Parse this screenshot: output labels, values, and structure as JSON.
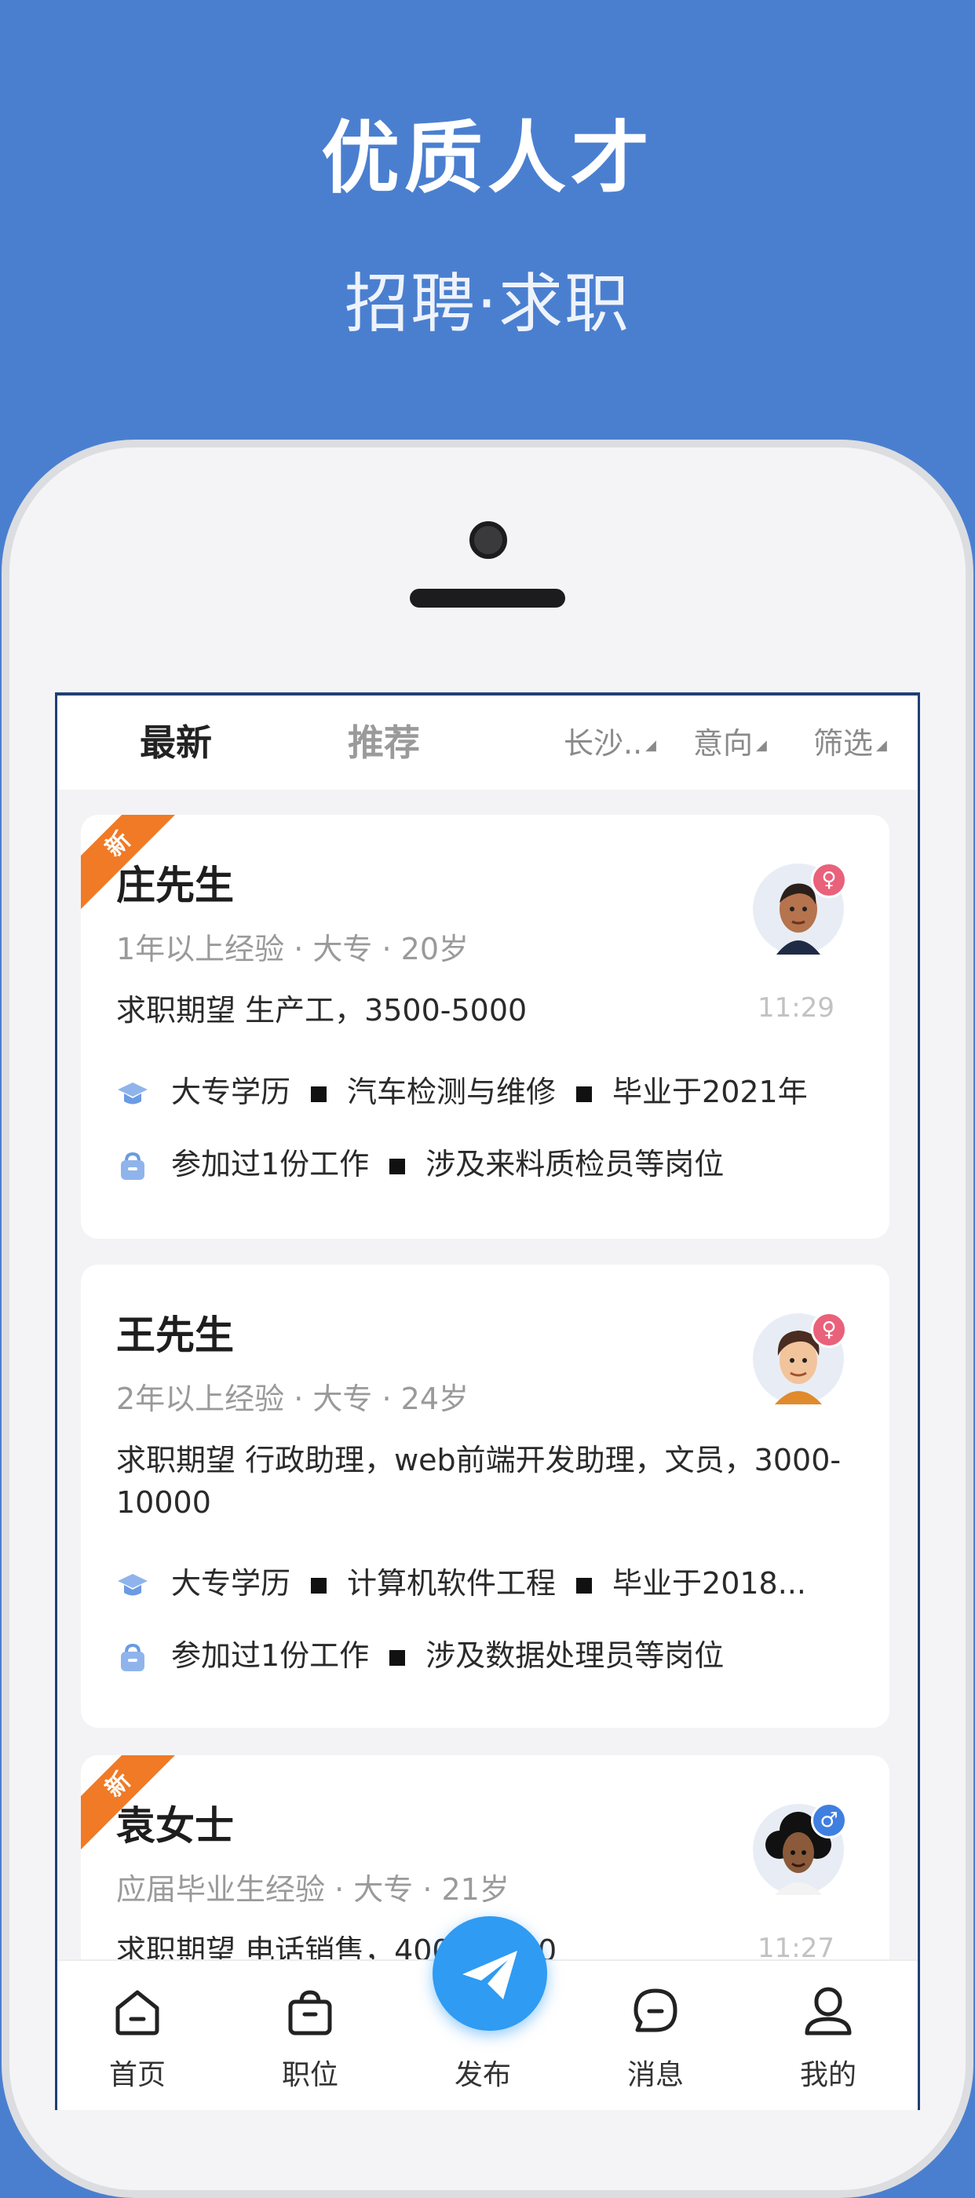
{
  "hero": {
    "title": "优质人才",
    "subtitle": "招聘·求职"
  },
  "tabs": [
    {
      "label": "最新"
    },
    {
      "label": "推荐"
    }
  ],
  "filters": {
    "city": "长沙..",
    "intent": "意向",
    "filter": "筛选"
  },
  "candidates": [
    {
      "badge": "新",
      "name": "庄先生",
      "meta": "1年以上经验 · 大专 · 20岁",
      "expectation": "求职期望 生产工，3500-5000",
      "time": "11:29",
      "gender_symbol": "♀",
      "education": [
        "大专学历",
        "汽车检测与维修",
        "毕业于2021年"
      ],
      "work": [
        "参加过1份工作",
        "涉及来料质检员等岗位"
      ]
    },
    {
      "badge": "",
      "name": "王先生",
      "meta": "2年以上经验 · 大专 · 24岁",
      "expectation": "求职期望 行政助理，web前端开发助理，文员，3000-10000",
      "time": "",
      "gender_symbol": "♀",
      "education": [
        "大专学历",
        "计算机软件工程",
        "毕业于2018..."
      ],
      "work": [
        "参加过1份工作",
        "涉及数据处理员等岗位"
      ]
    },
    {
      "badge": "新",
      "name": "袁女士",
      "meta": "应届毕业生经验 · 大专 · 21岁",
      "expectation": "求职期望 电话销售，4000-6000",
      "time": "11:27",
      "gender_symbol": "♂",
      "education": [],
      "work": []
    }
  ],
  "bottom_nav": [
    {
      "label": "首页",
      "icon": "home-icon"
    },
    {
      "label": "职位",
      "icon": "briefcase-icon"
    },
    {
      "label": "发布",
      "icon": "paper-plane-icon"
    },
    {
      "label": "消息",
      "icon": "message-icon"
    },
    {
      "label": "我的",
      "icon": "user-icon"
    }
  ],
  "colors": {
    "brand_blue": "#4a7fd0",
    "badge_orange": "#f07a25",
    "publish_blue": "#2f9bf2"
  }
}
